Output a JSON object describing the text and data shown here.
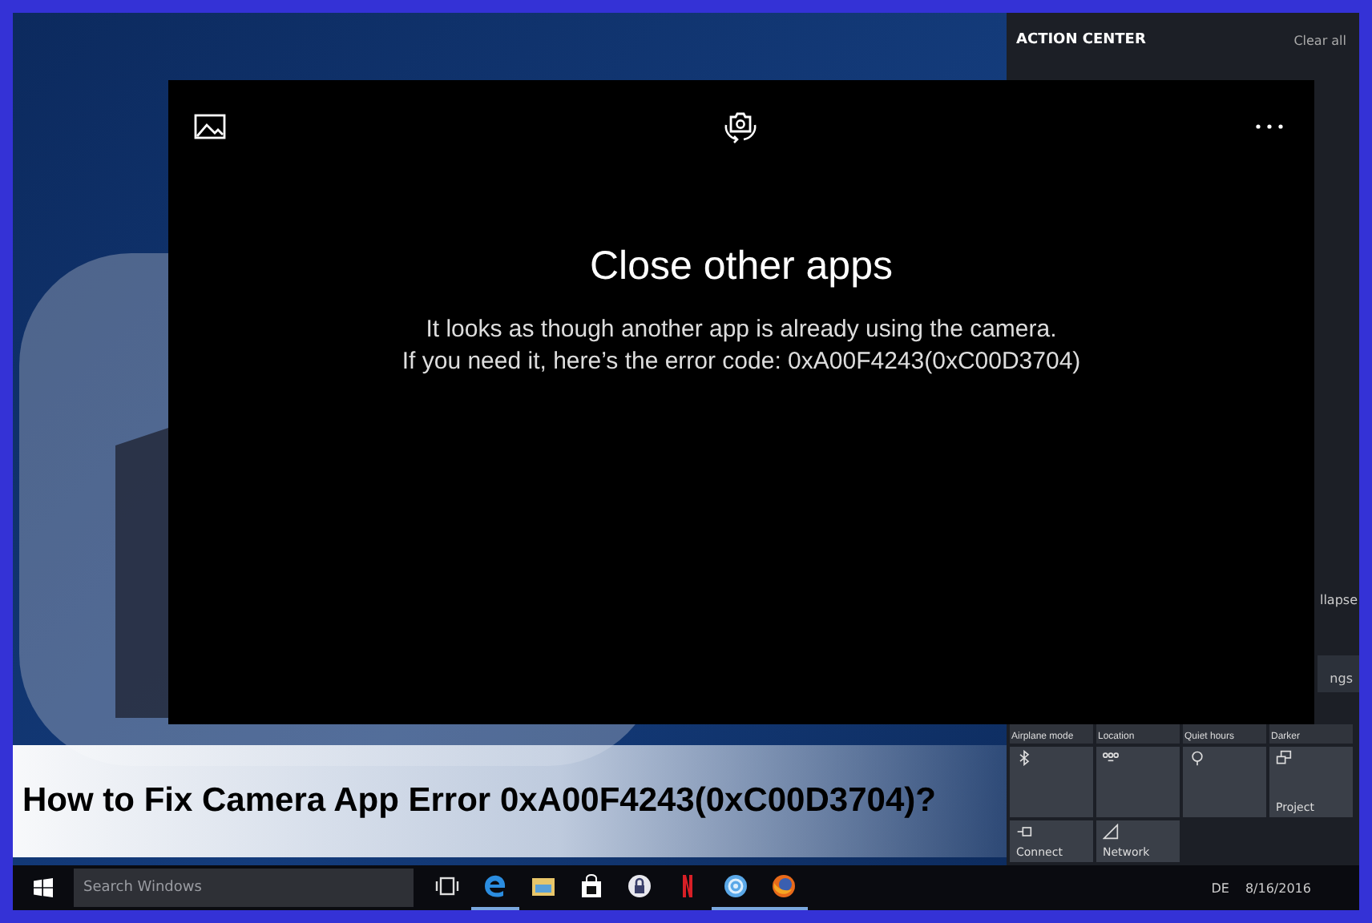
{
  "banner": {
    "title": "How to Fix Camera App Error 0xA00F4243(0xC00D3704)?"
  },
  "camera_window": {
    "heading": "Close other apps",
    "message_lines": [
      "It looks as though another app is already using the camera.",
      "If you need it, here’s the error code: 0xA00F4243(0xC00D3704)"
    ]
  },
  "action_center": {
    "title": "ACTION CENTER",
    "clear_all": "Clear all",
    "collapse": "llapse",
    "settings_tile": "ngs",
    "quick_actions": [
      {
        "kind": "plain",
        "label": "Airplane mode"
      },
      {
        "kind": "plain",
        "label": "Location"
      },
      {
        "kind": "plain",
        "label": "Quiet hours"
      },
      {
        "kind": "plain",
        "label": "Darker"
      },
      {
        "kind": "bluetooth"
      },
      {
        "kind": "vpn"
      },
      {
        "kind": "bulb"
      },
      {
        "kind": "project",
        "label": "Project"
      },
      {
        "kind": "connect",
        "label": "Connect"
      },
      {
        "kind": "network",
        "label": "Network"
      }
    ]
  },
  "taskbar": {
    "search": {
      "placeholder": "Search Windows"
    },
    "apps": [
      {
        "kind": "taskview",
        "running": false
      },
      {
        "kind": "edge",
        "running": true
      },
      {
        "kind": "explorer",
        "running": false
      },
      {
        "kind": "store",
        "running": false
      },
      {
        "kind": "lock",
        "running": false
      },
      {
        "kind": "netflix",
        "running": false
      },
      {
        "kind": "disc",
        "running": true
      },
      {
        "kind": "firefox",
        "running": true
      }
    ],
    "tray": {
      "language": "DE",
      "date": "8/16/2016"
    }
  }
}
